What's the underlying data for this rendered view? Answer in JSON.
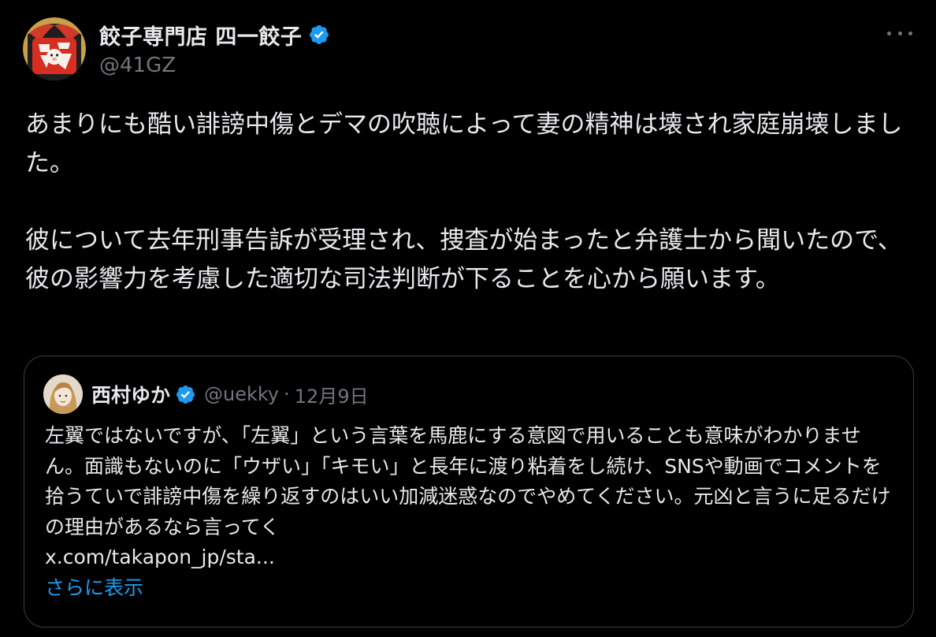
{
  "tweet": {
    "author": {
      "display_name": "餃子専門店 四一餃子",
      "handle": "@41GZ",
      "verified": true,
      "avatar_icon": "gyoza-restaurant-logo"
    },
    "more_icon": "more-horizontal-icon",
    "text": "あまりにも酷い誹謗中傷とデマの吹聴によって妻の精神は壊され家庭崩壊しました。\n\n彼について去年刑事告訴が受理され、捜査が始まったと弁護士から聞いたので、彼の影響力を考慮した適切な司法判断が下ることを心から願います。"
  },
  "quote": {
    "author": {
      "display_name": "西村ゆか",
      "handle": "@uekky",
      "separator": "·",
      "date": "12月9日",
      "verified": true,
      "avatar_icon": "user-avatar"
    },
    "text": "左翼ではないですが、「左翼」という言葉を馬鹿にする意図で用いることも意味がわかりません。面識もないのに「ウザい」「キモい」と長年に渡り粘着をし続け、SNSや動画でコメントを拾うていで誹謗中傷を繰り返すのはいい加減迷惑なのでやめてください。元凶と言うに足るだけの理由があるなら言ってく",
    "link": "x.com/takapon_jp/sta...",
    "show_more": "さらに表示"
  },
  "colors": {
    "background": "#000000",
    "text": "#e7e9ea",
    "secondary": "#71767b",
    "accent": "#1d9bf0",
    "border": "#3a3d42"
  }
}
